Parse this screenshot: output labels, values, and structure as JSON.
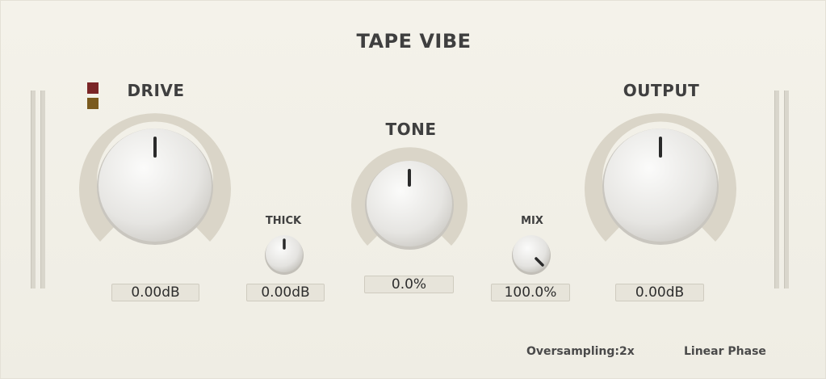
{
  "app": {
    "title": "TAPE VIBE"
  },
  "controls": {
    "drive": {
      "label": "DRIVE",
      "value": "0.00dB"
    },
    "thick": {
      "label": "THICK",
      "value": "0.00dB"
    },
    "tone": {
      "label": "TONE",
      "value": "0.0%"
    },
    "mix": {
      "label": "MIX",
      "value": "100.0%"
    },
    "output": {
      "label": "OUTPUT",
      "value": "0.00dB"
    }
  },
  "indicators": {
    "led_top_color": "#7a2526",
    "led_bottom_color": "#7a5a1e"
  },
  "footer": {
    "oversampling": "Oversampling:2x",
    "phase": "Linear Phase"
  },
  "icons": [
    "drive-knob",
    "thick-knob",
    "tone-knob",
    "mix-knob",
    "output-knob",
    "input-meter",
    "output-meter"
  ]
}
